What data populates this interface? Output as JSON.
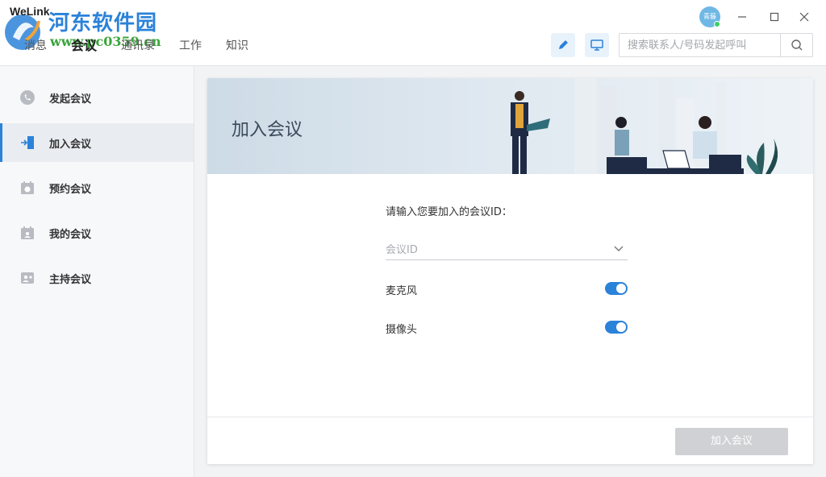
{
  "app": {
    "title": "WeLink",
    "watermark_title": "河东软件园",
    "watermark_url": "www.pc0359.cn"
  },
  "nav": {
    "items": [
      {
        "label": "消息"
      },
      {
        "label": "会议"
      },
      {
        "label": "通讯录"
      },
      {
        "label": "工作"
      },
      {
        "label": "知识"
      }
    ],
    "active_index": 1
  },
  "header": {
    "avatar_text": "青藤",
    "search_placeholder": "搜索联系人/号码发起呼叫"
  },
  "sidebar": {
    "items": [
      {
        "label": "发起会议",
        "icon": "phone-icon"
      },
      {
        "label": "加入会议",
        "icon": "enter-icon"
      },
      {
        "label": "预约会议",
        "icon": "calendar-clock-icon"
      },
      {
        "label": "我的会议",
        "icon": "calendar-user-icon"
      },
      {
        "label": "主持会议",
        "icon": "host-icon"
      }
    ],
    "active_index": 1
  },
  "card": {
    "title": "加入会议",
    "prompt": "请输入您要加入的会议ID：",
    "meeting_id_placeholder": "会议ID",
    "toggles": [
      {
        "label": "麦克风",
        "on": true
      },
      {
        "label": "摄像头",
        "on": true
      }
    ],
    "join_button": "加入会议"
  },
  "colors": {
    "accent": "#2b82d9",
    "button_disabled": "#cfd1d4"
  }
}
